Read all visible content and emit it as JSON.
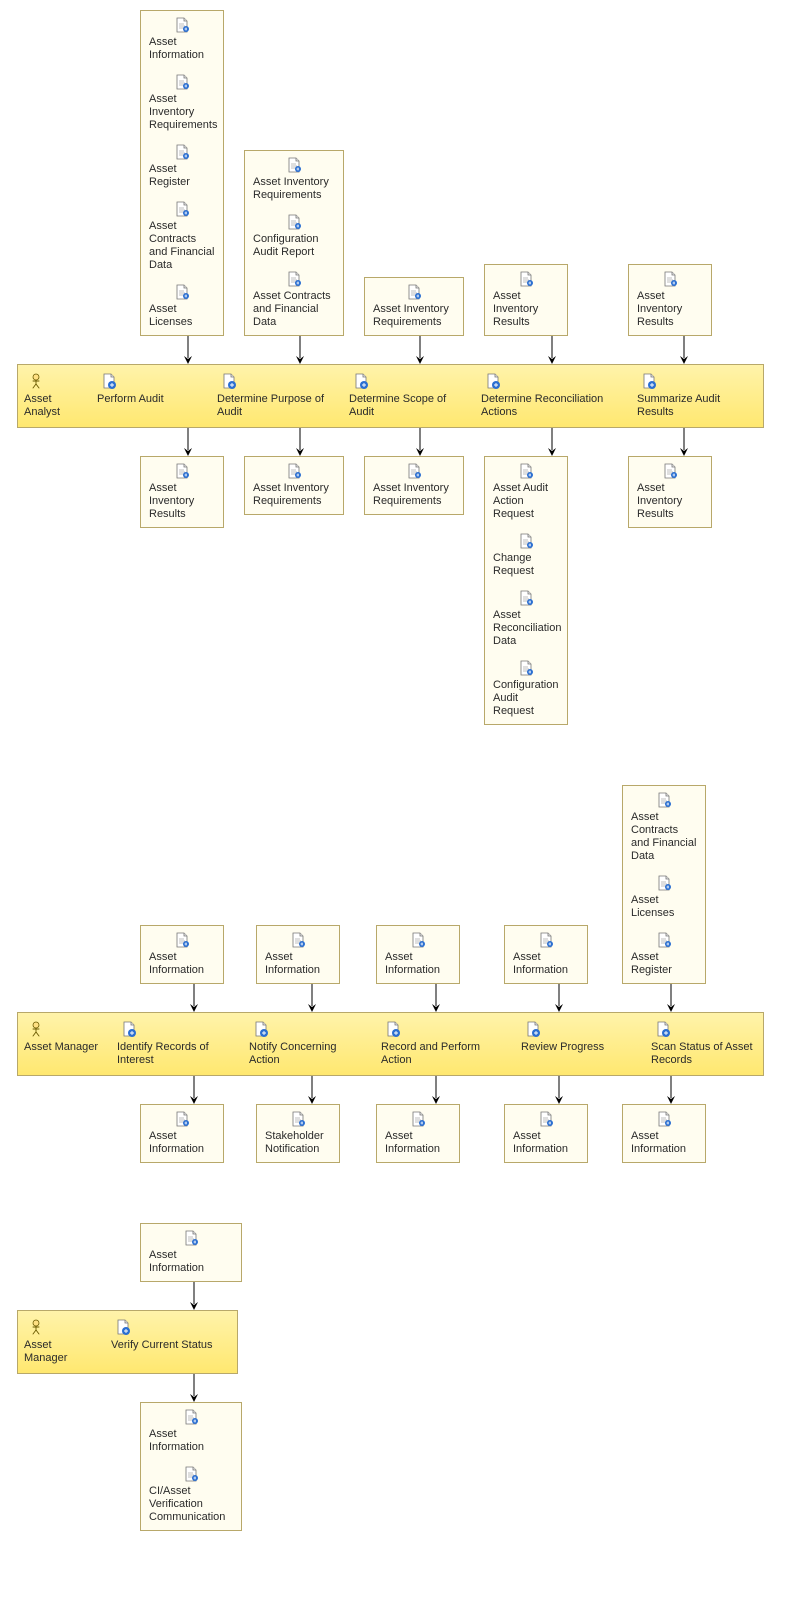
{
  "lane1": {
    "actor": "Asset Analyst",
    "columns": [
      {
        "inputs": [
          "Asset Information",
          "Asset Inventory Requirements",
          "Asset Register",
          "Asset Contracts and Financial Data",
          "Asset Licenses"
        ],
        "task": "Perform Audit",
        "outputs": [
          "Asset Inventory Results"
        ]
      },
      {
        "inputs": [
          "Asset Inventory Requirements",
          "Configuration Audit Report",
          "Asset Contracts and Financial Data"
        ],
        "task": "Determine Purpose of Audit",
        "outputs": [
          "Asset Inventory Requirements"
        ]
      },
      {
        "inputs": [
          "Asset Inventory Requirements"
        ],
        "task": "Determine Scope of Audit",
        "outputs": [
          "Asset Inventory Requirements"
        ]
      },
      {
        "inputs": [
          "Asset Inventory Results"
        ],
        "task": "Determine Reconciliation Actions",
        "outputs": [
          "Asset Audit Action Request",
          "Change Request",
          "Asset Reconciliation Data",
          "Configuration Audit Request"
        ]
      },
      {
        "inputs": [
          "Asset Inventory Results"
        ],
        "task": "Summarize Audit Results",
        "outputs": [
          "Asset Inventory Results"
        ]
      }
    ]
  },
  "lane2": {
    "actor": "Asset Manager",
    "columns": [
      {
        "inputs": [
          "Asset Information"
        ],
        "task": "Identify Records of Interest",
        "outputs": [
          "Asset Information"
        ]
      },
      {
        "inputs": [
          "Asset Information"
        ],
        "task": "Notify Concerning Action",
        "outputs": [
          "Stakeholder Notification"
        ]
      },
      {
        "inputs": [
          "Asset Information"
        ],
        "task": "Record and Perform Action",
        "outputs": [
          "Asset Information"
        ]
      },
      {
        "inputs": [
          "Asset Information"
        ],
        "task": "Review Progress",
        "outputs": [
          "Asset Information"
        ]
      },
      {
        "inputs": [
          "Asset Contracts and Financial Data",
          "Asset Licenses",
          "Asset Register"
        ],
        "task": "Scan Status of Asset Records",
        "outputs": [
          "Asset Information"
        ]
      }
    ]
  },
  "lane3": {
    "actor": "Asset Manager",
    "columns": [
      {
        "inputs": [
          "Asset Information"
        ],
        "task": "Verify Current Status",
        "outputs": [
          "Asset Information",
          "CI/Asset Verification Communication"
        ]
      }
    ]
  }
}
